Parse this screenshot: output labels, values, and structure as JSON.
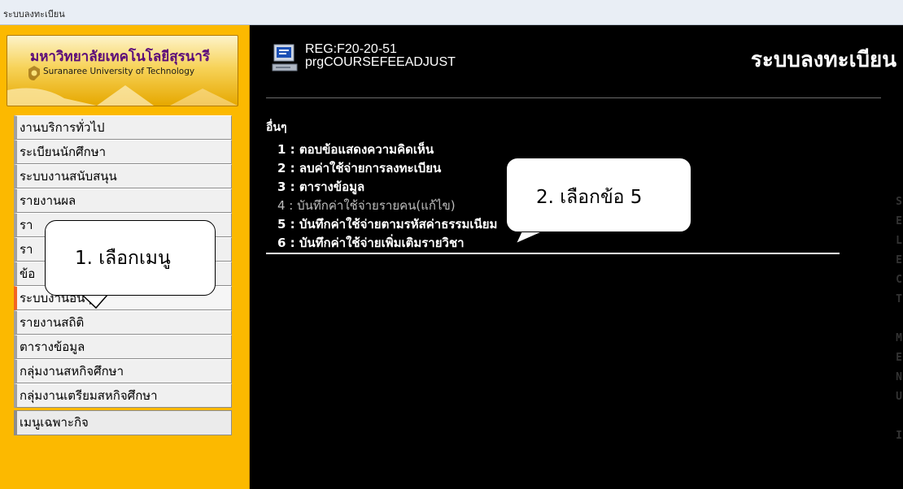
{
  "window": {
    "title": "ระบบลงทะเบียน"
  },
  "logo": {
    "thai_name": "มหาวิทยาลัยเทคโนโลยีสุรนารี",
    "english_name": "Suranaree University of Technology"
  },
  "sidebar": {
    "items": [
      {
        "label": "งานบริการทั่วไป"
      },
      {
        "label": "ระเบียนนักศึกษา"
      },
      {
        "label": "ระบบงานสนับสนุน"
      },
      {
        "label": "รายงานผล"
      },
      {
        "label": "รา"
      },
      {
        "label": "รา"
      },
      {
        "label": "ข้อ"
      },
      {
        "label": "ระบบงานอื่นๆ",
        "active": true
      },
      {
        "label": "รายงานสถิติ"
      },
      {
        "label": "ตารางข้อมูล"
      },
      {
        "label": "กลุ่มงานสหกิจศึกษา"
      },
      {
        "label": "กลุ่มงานเตรียมสหกิจศึกษา"
      }
    ],
    "special": {
      "label": "เมนูเฉพาะกิจ"
    }
  },
  "header": {
    "form_code": "REG:F20-20-51",
    "program_name": "prgCOURSEFEEADJUST",
    "app_title": "ระบบลงทะเบียน",
    "icon": "computer-icon"
  },
  "section": {
    "title": "อื่นๆ",
    "options": [
      {
        "label": "1 : ตอบข้อแสดงความคิดเห็น"
      },
      {
        "label": "2 : ลบค่าใช้จ่ายการลงทะเบียน"
      },
      {
        "label": "3 : ตารางข้อมูล"
      },
      {
        "label": "4 : บันทึกค่าใช้จ่ายรายคน(แก้ไข)",
        "dimmed": true
      },
      {
        "label": "5 : บันทึกค่าใช้จ่ายตามรหัสค่าธรรมเนียม"
      },
      {
        "label": "6 : บันทึกค่าใช้จ่ายเพิ่มเติมรายวิชา"
      }
    ]
  },
  "side_text": "SELECT MENU I",
  "callouts": {
    "step1": "1.  เลือกเมนู",
    "step2": "2.  เลือกข้อ 5"
  },
  "colors": {
    "sidebar_bg": "#fcb900",
    "content_bg": "#000000",
    "active_marker": "#f26522"
  }
}
